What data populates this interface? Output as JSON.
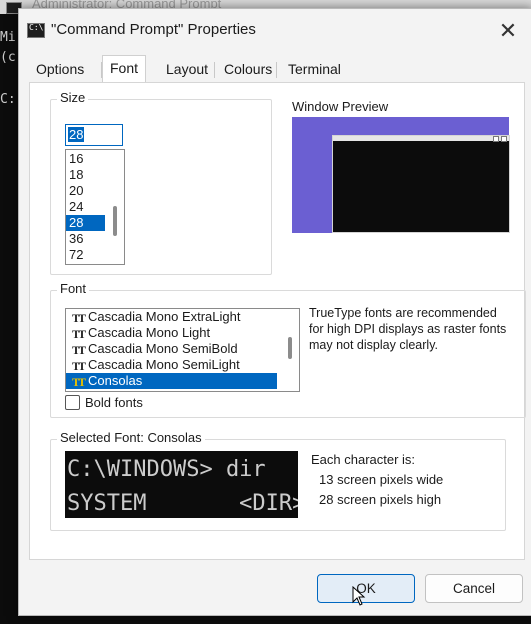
{
  "background_console": {
    "title": "Administrator: Command Prompt",
    "lines": [
      "Mi",
      "(c",
      "",
      "C:"
    ]
  },
  "dialog": {
    "title": "\"Command Prompt\" Properties",
    "title_icon_text": "C:\\"
  },
  "tabs": [
    "Options",
    "Font",
    "Layout",
    "Colours",
    "Terminal"
  ],
  "active_tab": "Font",
  "size": {
    "label": "Size",
    "input_value": "28",
    "items": [
      "16",
      "18",
      "20",
      "24",
      "28",
      "36",
      "72"
    ],
    "selected": "28"
  },
  "window_preview": {
    "label": "Window Preview"
  },
  "font": {
    "label": "Font",
    "items": [
      "Cascadia Mono ExtraLight",
      "Cascadia Mono Light",
      "Cascadia Mono SemiBold",
      "Cascadia Mono SemiLight",
      "Consolas"
    ],
    "selected": "Consolas",
    "icon_glyph": "TT",
    "note": "TrueType fonts are recommended for high DPI displays as raster fonts may not display clearly.",
    "bold_label": "Bold fonts",
    "bold_checked": false
  },
  "selected_font": {
    "label": "Selected Font: Consolas",
    "preview_lines": [
      "C:\\WINDOWS> dir",
      "SYSTEM       <DIR>"
    ],
    "char_heading": "Each character is:",
    "char_width": "13 screen pixels wide",
    "char_height": "28 screen pixels high"
  },
  "buttons": {
    "ok": "OK",
    "cancel": "Cancel"
  },
  "colors": {
    "accent": "#0067c0",
    "preview_desktop": "#6b5fd2",
    "console_bg": "#0c0c0c"
  }
}
